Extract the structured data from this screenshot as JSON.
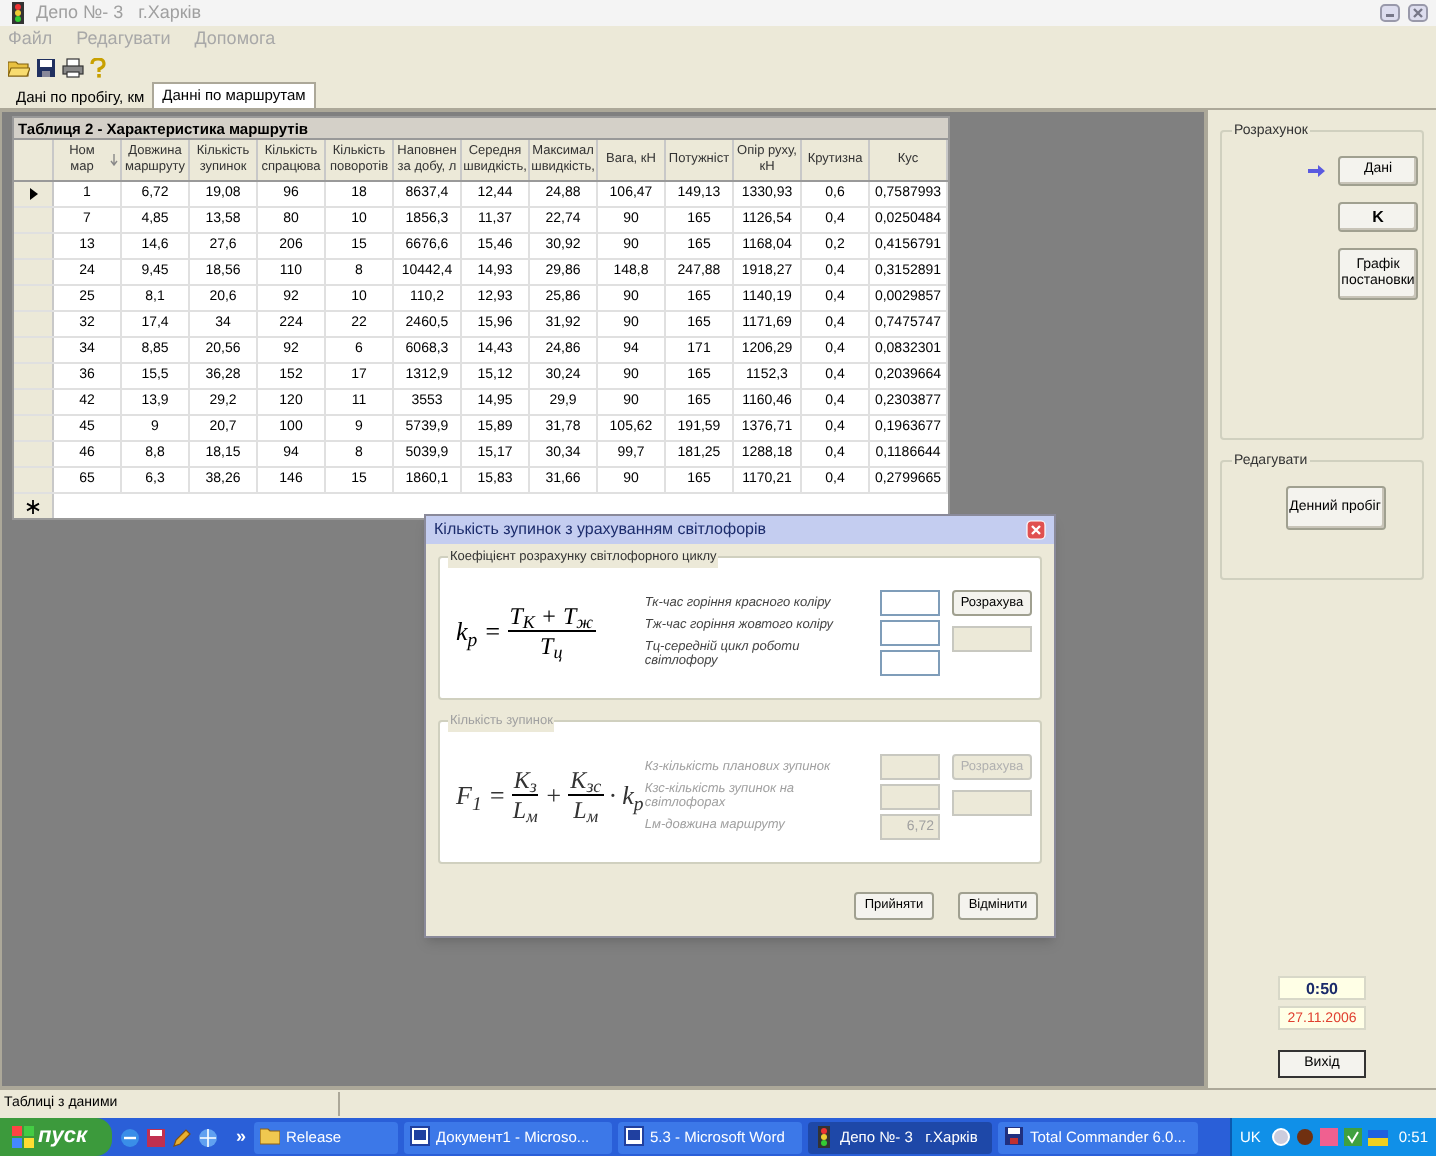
{
  "window": {
    "title": "Депо №- 3   г.Харків"
  },
  "menu": [
    {
      "label": "Файл",
      "disabled": true
    },
    {
      "label": "Редагувати",
      "disabled": true
    },
    {
      "label": "Допомога",
      "disabled": true
    }
  ],
  "tabs": [
    {
      "label": "Дані по пробігу, км",
      "selected": false
    },
    {
      "label": "Данні по маршрутам",
      "selected": true
    }
  ],
  "table": {
    "title": "Таблиця 2 - Характеристика маршрутів",
    "columns": [
      {
        "label": "Ном мар",
        "sorted": true
      },
      {
        "label": "Довжина маршруту",
        "sorted": false
      },
      {
        "label": "Кількість зупинок",
        "sorted": false
      },
      {
        "label": "Кількість спрацюва",
        "sorted": false
      },
      {
        "label": "Кількість поворотів",
        "sorted": false
      },
      {
        "label": "Наповнен за добу, л",
        "sorted": false
      },
      {
        "label": "Середня швидкість,",
        "sorted": false
      },
      {
        "label": "Максимал швидкість,",
        "sorted": false
      },
      {
        "label": "Вага, кН",
        "sorted": false
      },
      {
        "label": "Потужніст",
        "sorted": false
      },
      {
        "label": "Опір руху, кН",
        "sorted": false
      },
      {
        "label": "Крутизна",
        "sorted": false
      },
      {
        "label": "Кус",
        "sorted": false
      }
    ],
    "rows": [
      {
        "selected": true,
        "cells": [
          "1",
          "6,72",
          "19,08",
          "96",
          "18",
          "8637,4",
          "12,44",
          "24,88",
          "106,47",
          "149,13",
          "1330,93",
          "0,6",
          "0,7587993"
        ]
      },
      {
        "selected": false,
        "cells": [
          "7",
          "4,85",
          "13,58",
          "80",
          "10",
          "1856,3",
          "11,37",
          "22,74",
          "90",
          "165",
          "1126,54",
          "0,4",
          "0,0250484"
        ]
      },
      {
        "selected": false,
        "cells": [
          "13",
          "14,6",
          "27,6",
          "206",
          "15",
          "6676,6",
          "15,46",
          "30,92",
          "90",
          "165",
          "1168,04",
          "0,2",
          "0,4156791"
        ]
      },
      {
        "selected": false,
        "cells": [
          "24",
          "9,45",
          "18,56",
          "110",
          "8",
          "10442,4",
          "14,93",
          "29,86",
          "148,8",
          "247,88",
          "1918,27",
          "0,4",
          "0,3152891"
        ]
      },
      {
        "selected": false,
        "cells": [
          "25",
          "8,1",
          "20,6",
          "92",
          "10",
          "110,2",
          "12,93",
          "25,86",
          "90",
          "165",
          "1140,19",
          "0,4",
          "0,0029857"
        ]
      },
      {
        "selected": false,
        "cells": [
          "32",
          "17,4",
          "34",
          "224",
          "22",
          "2460,5",
          "15,96",
          "31,92",
          "90",
          "165",
          "1171,69",
          "0,4",
          "0,7475747"
        ]
      },
      {
        "selected": false,
        "cells": [
          "34",
          "8,85",
          "20,56",
          "92",
          "6",
          "6068,3",
          "14,43",
          "24,86",
          "94",
          "171",
          "1206,29",
          "0,4",
          "0,0832301"
        ]
      },
      {
        "selected": false,
        "cells": [
          "36",
          "15,5",
          "36,28",
          "152",
          "17",
          "1312,9",
          "15,12",
          "30,24",
          "90",
          "165",
          "1152,3",
          "0,4",
          "0,2039664"
        ]
      },
      {
        "selected": false,
        "cells": [
          "42",
          "13,9",
          "29,2",
          "120",
          "11",
          "3553",
          "14,95",
          "29,9",
          "90",
          "165",
          "1160,46",
          "0,4",
          "0,2303877"
        ]
      },
      {
        "selected": false,
        "cells": [
          "45",
          "9",
          "20,7",
          "100",
          "9",
          "5739,9",
          "15,89",
          "31,78",
          "105,62",
          "191,59",
          "1376,71",
          "0,4",
          "0,1963677"
        ]
      },
      {
        "selected": false,
        "cells": [
          "46",
          "8,8",
          "18,15",
          "94",
          "8",
          "5039,9",
          "15,17",
          "30,34",
          "99,7",
          "181,25",
          "1288,18",
          "0,4",
          "0,1186644"
        ]
      },
      {
        "selected": false,
        "cells": [
          "65",
          "6,3",
          "38,26",
          "146",
          "15",
          "1860,1",
          "15,83",
          "31,66",
          "90",
          "165",
          "1170,21",
          "0,4",
          "0,2799665"
        ]
      }
    ]
  },
  "right_panel": {
    "groups": [
      {
        "title": "Розрахунок",
        "buttons": [
          {
            "label": "Дані",
            "kind": "plain",
            "current": true
          },
          {
            "label": "K",
            "kind": "bold",
            "current": false
          },
          {
            "label": "Графік постановки",
            "kind": "tall",
            "current": false
          }
        ]
      },
      {
        "title": "Редагувати",
        "buttons": [
          {
            "label": "Денний пробіг",
            "kind": "wide",
            "current": false
          }
        ]
      }
    ],
    "clock": "0:50",
    "date": "27.11.2006",
    "exit_button": "Вихід"
  },
  "dialog": {
    "title": "Кількість зупинок з урахуванням світлофорів",
    "sections": [
      {
        "title": "Коефіцієнт розрахунку світлофорного циклу",
        "disabled": false,
        "formula": [
          {
            "kind": "text",
            "text": "k$_{p}$ ="
          },
          {
            "kind": "fraction",
            "num": "T$_{К}$ + T$_{ж}$",
            "den": "T$_{ц}$"
          }
        ],
        "fields": [
          {
            "label": "Тк-час горіння красного коліру"
          },
          {
            "label": "Тж-час горіння жовтого коліру"
          },
          {
            "label": "Тц-середній цикл роботи світлофору"
          }
        ],
        "button": "Розрахува"
      },
      {
        "title": "Кількість зупинок",
        "disabled": true,
        "formula": [
          {
            "kind": "text",
            "text": "F$_{1}$ ="
          },
          {
            "kind": "fraction",
            "num": "K$_{з}$",
            "den": "L$_{м}$"
          },
          {
            "kind": "text",
            "text": "+"
          },
          {
            "kind": "fraction",
            "num": "K$_{зс}$",
            "den": "L$_{м}$"
          },
          {
            "kind": "text",
            "text": "· k$_{p}$"
          }
        ],
        "fields": [
          {
            "label": "Кз-кількість планових зупинок"
          },
          {
            "label": "Кзс-кількість зупинок на світлофорах"
          },
          {
            "label": "Lм-довжина маршруту",
            "value": "6,72"
          }
        ],
        "button": "Розрахува"
      }
    ],
    "buttons": [
      "Прийняти",
      "Відмінити"
    ]
  },
  "status_bar": [
    "Таблиці з даними"
  ],
  "taskbar": {
    "start": "пуск",
    "more": "»",
    "tasks": [
      {
        "label": "Release",
        "kind": "folder",
        "active": false
      },
      {
        "label": "Документ1 - Microso...",
        "kind": "doc",
        "active": false
      },
      {
        "label": "5.3 - Microsoft Word",
        "kind": "doc",
        "active": false
      },
      {
        "label": "Депо №- 3   г.Харків",
        "kind": "app",
        "active": true
      },
      {
        "label": "Total Commander 6.0...",
        "kind": "disk",
        "active": false
      }
    ],
    "language": "UK",
    "clock": "0:51"
  }
}
